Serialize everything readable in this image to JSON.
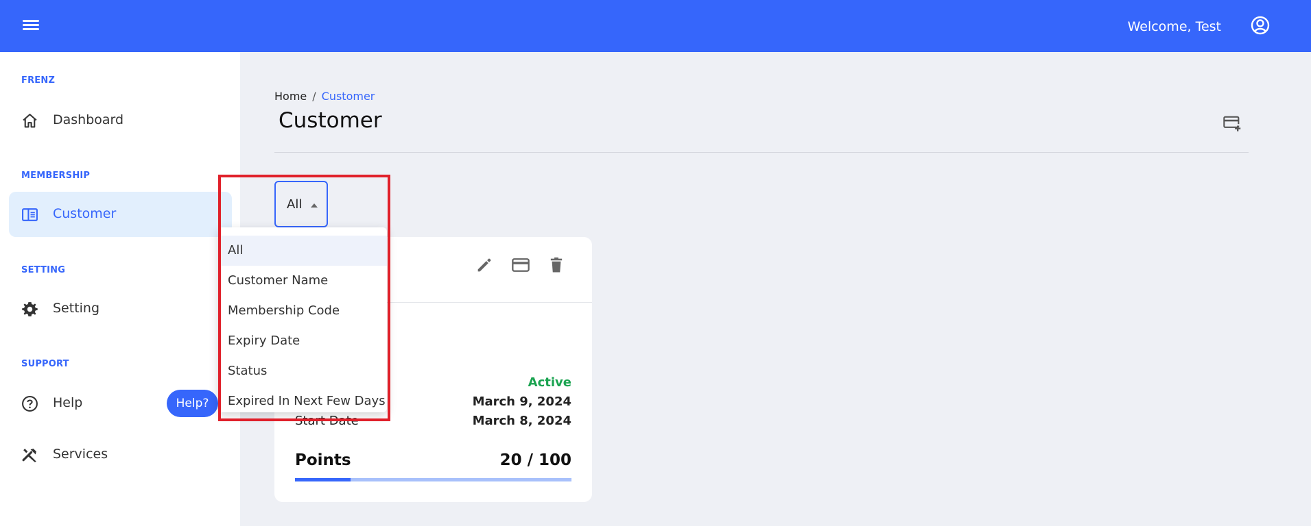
{
  "topbar": {
    "menu_icon": "hamburger-menu-icon",
    "welcome_text": "Welcome, Test",
    "account_icon": "account-circle-icon",
    "bg_color": "#3666fb"
  },
  "sidebar": {
    "sections": [
      {
        "label": "FRENZ",
        "items": [
          {
            "label": "Dashboard",
            "icon": "home-icon"
          }
        ]
      },
      {
        "label": "MEMBERSHIP",
        "items": [
          {
            "label": "Customer",
            "icon": "membership-card-icon",
            "active": true
          }
        ]
      },
      {
        "label": "SETTING",
        "items": [
          {
            "label": "Setting",
            "icon": "gear-icon"
          }
        ]
      },
      {
        "label": "SUPPORT",
        "items": [
          {
            "label": "Help",
            "icon": "help-circle-icon"
          },
          {
            "label": "Services",
            "icon": "tools-icon"
          }
        ]
      }
    ],
    "help_badge": "Help?"
  },
  "main": {
    "breadcrumb": {
      "home": "Home",
      "separator": "/",
      "current": "Customer"
    },
    "title": "Customer",
    "add_card_icon": "add-card-icon",
    "filter": {
      "selected": "All",
      "options": [
        "All",
        "Customer Name",
        "Membership Code",
        "Expiry Date",
        "Status",
        "Expired In Next Few Days"
      ],
      "open": true
    },
    "card": {
      "actions": [
        "edit-icon",
        "card-icon",
        "delete-icon"
      ],
      "status_value": "Active",
      "expiry_value": "March 9, 2024",
      "start_label": "Start Date",
      "start_value": "March 8, 2024",
      "points_label": "Points",
      "points_value": "20 / 100",
      "points_progress": 0.2
    }
  },
  "colors": {
    "accent": "#3666fb",
    "active_status": "#1aa350",
    "highlight": "#e0202a"
  }
}
